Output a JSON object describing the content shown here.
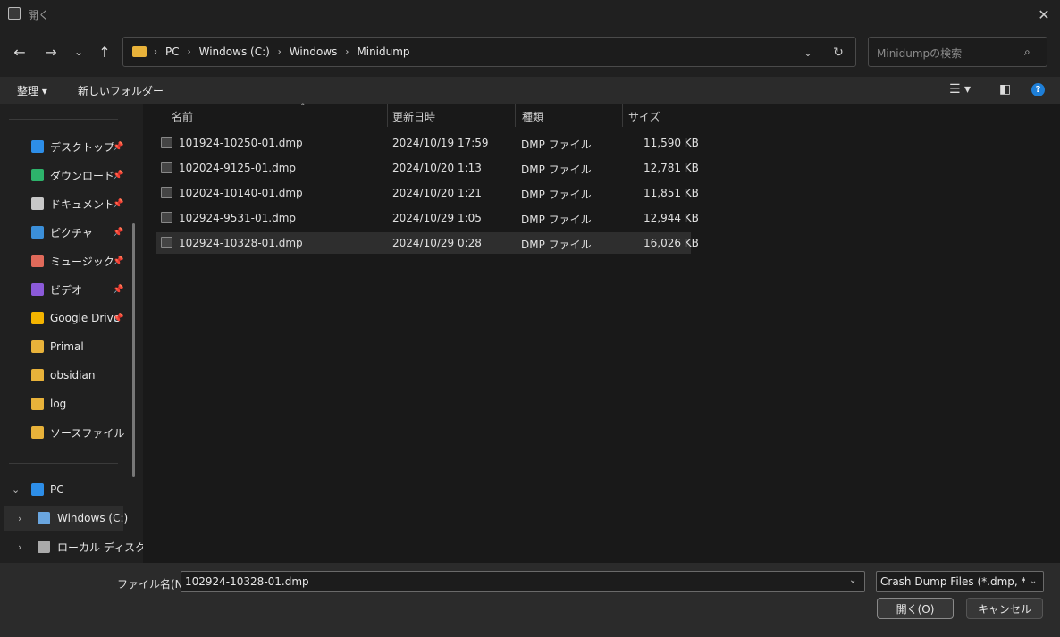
{
  "window": {
    "title": "開く",
    "close": "✕"
  },
  "nav": {
    "back": "←",
    "forward": "→",
    "recent": "⌄",
    "up": "↑",
    "breadcrumbs": [
      "PC",
      "Windows (C:)",
      "Windows",
      "Minidump"
    ],
    "sep": "›",
    "dropdown": "⌄",
    "refresh": "↻",
    "search_placeholder": "Minidumpの検索",
    "search_icon": "⌕"
  },
  "toolbar": {
    "organize": "整理 ▾",
    "new_folder": "新しいフォルダー",
    "view_icon": "☰ ▾",
    "pane_icon": "◧",
    "help": "?"
  },
  "sidebar": {
    "quick": [
      {
        "label": "デスクトップ",
        "icon": "desktop-icon",
        "color": "#2d8ee8",
        "pinned": true
      },
      {
        "label": "ダウンロード",
        "icon": "download-icon",
        "color": "#2db36b",
        "pinned": true
      },
      {
        "label": "ドキュメント",
        "icon": "document-icon",
        "color": "#c8c8c8",
        "pinned": true
      },
      {
        "label": "ピクチャ",
        "icon": "picture-icon",
        "color": "#3b8fd9",
        "pinned": true
      },
      {
        "label": "ミュージック",
        "icon": "music-icon",
        "color": "#e06a5a",
        "pinned": true
      },
      {
        "label": "ビデオ",
        "icon": "video-icon",
        "color": "#8b5ad9",
        "pinned": true
      },
      {
        "label": "Google Drive",
        "icon": "google-drive-icon",
        "color": "#f4b400",
        "pinned": true
      },
      {
        "label": "Primal",
        "icon": "folder-icon",
        "color": "#e8b23a",
        "pinned": false
      },
      {
        "label": "obsidian",
        "icon": "folder-icon",
        "color": "#e8b23a",
        "pinned": false
      },
      {
        "label": "log",
        "icon": "folder-icon",
        "color": "#e8b23a",
        "pinned": false
      },
      {
        "label": "ソースファイル",
        "icon": "folder-icon",
        "color": "#e8b23a",
        "pinned": false
      }
    ],
    "pin": "📌",
    "tree": [
      {
        "label": "PC",
        "chev": "⌄",
        "icon": "pc-icon",
        "color": "#2d8ee8"
      },
      {
        "label": "Windows (C:)",
        "chev": "›",
        "icon": "drive-icon",
        "color": "#6aa6e0"
      },
      {
        "label": "ローカル ディスク",
        "chev": "›",
        "icon": "disk-icon",
        "color": "#aaaaaa"
      }
    ]
  },
  "columns": [
    "名前",
    "更新日時",
    "種類",
    "サイズ"
  ],
  "sort_caret": "^",
  "files": [
    {
      "name": "101924-10250-01.dmp",
      "date": "2024/10/19 17:59",
      "type": "DMP ファイル",
      "size": "11,590 KB"
    },
    {
      "name": "102024-9125-01.dmp",
      "date": "2024/10/20 1:13",
      "type": "DMP ファイル",
      "size": "12,781 KB"
    },
    {
      "name": "102024-10140-01.dmp",
      "date": "2024/10/20 1:21",
      "type": "DMP ファイル",
      "size": "11,851 KB"
    },
    {
      "name": "102924-9531-01.dmp",
      "date": "2024/10/29 1:05",
      "type": "DMP ファイル",
      "size": "12,944 KB"
    },
    {
      "name": "102924-10328-01.dmp",
      "date": "2024/10/29 0:28",
      "type": "DMP ファイル",
      "size": "16,026 KB"
    }
  ],
  "footer": {
    "filename_label": "ファイル名(N):",
    "filename_value": "102924-10328-01.dmp",
    "filetype": "Crash Dump Files (*.dmp, *.hdmp)",
    "dd": "⌄",
    "open": "開く(O)",
    "cancel": "キャンセル"
  }
}
